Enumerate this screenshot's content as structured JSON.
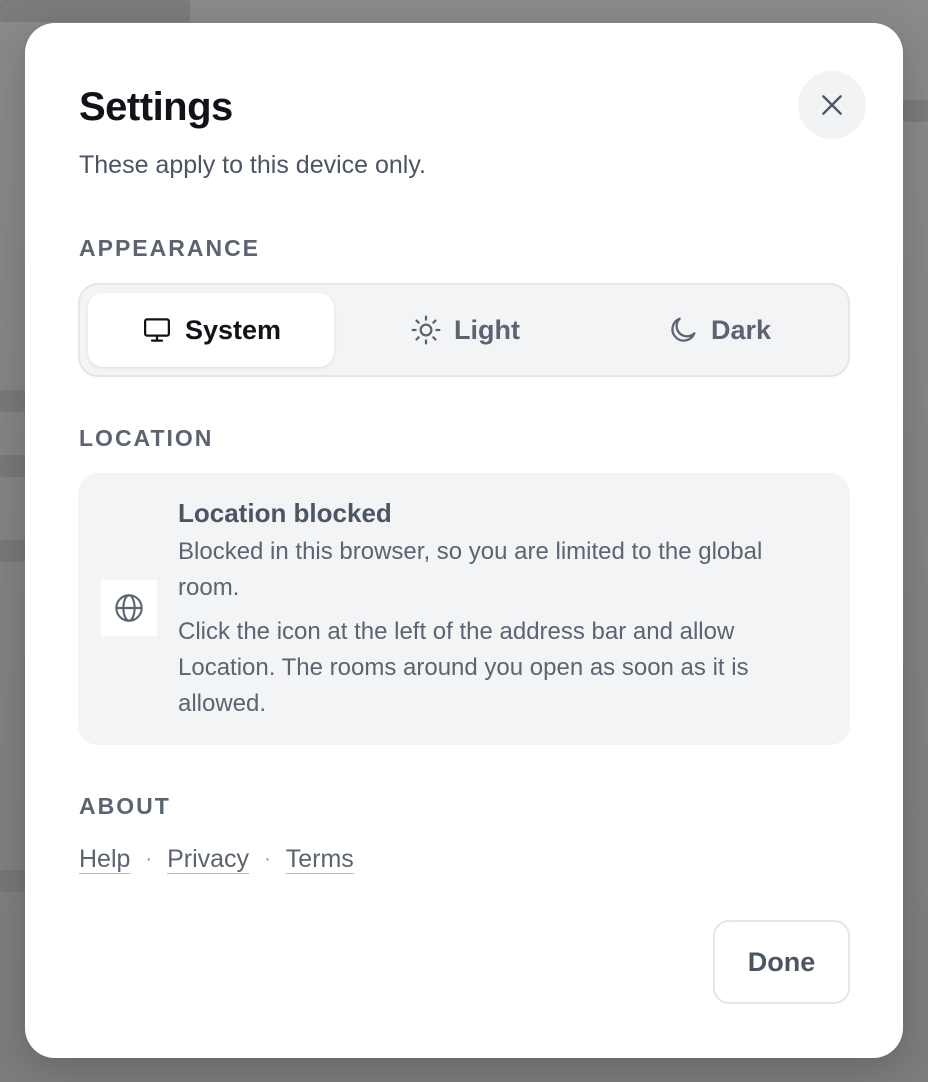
{
  "dialog": {
    "title": "Settings",
    "subtitle": "These apply to this device only.",
    "close_icon": "close-icon"
  },
  "appearance": {
    "label": "APPEARANCE",
    "options": [
      {
        "label": "System",
        "icon": "monitor-icon",
        "selected": true
      },
      {
        "label": "Light",
        "icon": "sun-icon",
        "selected": false
      },
      {
        "label": "Dark",
        "icon": "moon-icon",
        "selected": false
      }
    ]
  },
  "location": {
    "label": "LOCATION",
    "icon": "globe-icon",
    "title": "Location blocked",
    "text1": "Blocked in this browser, so you are limited to the global room.",
    "text2": "Click the icon at the left of the address bar and allow Location. The rooms around you open as soon as it is allowed."
  },
  "about": {
    "label": "ABOUT",
    "links": [
      "Help",
      "Privacy",
      "Terms"
    ],
    "separator": "·"
  },
  "footer": {
    "done_label": "Done"
  },
  "colors": {
    "text_primary": "#111318",
    "text_secondary": "#5b6470",
    "surface_muted": "#f3f4f6"
  }
}
